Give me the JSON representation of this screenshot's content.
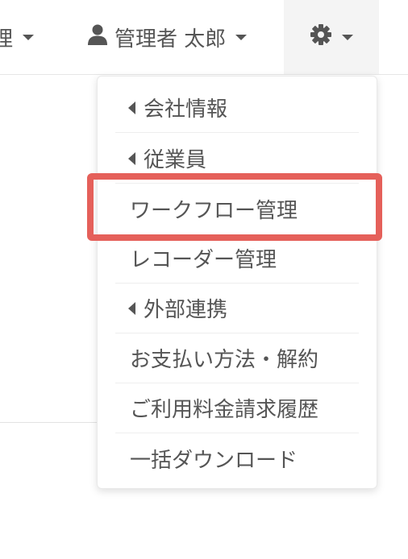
{
  "navbar": {
    "clipped_label": "理",
    "user_name": "管理者 太郎",
    "icons": {
      "user": "user-icon",
      "settings": "gear-icon"
    }
  },
  "settings_menu": {
    "items": [
      {
        "label": "会社情報",
        "submenu": true
      },
      {
        "label": "従業員",
        "submenu": true
      },
      {
        "label": "ワークフロー管理",
        "submenu": false,
        "highlighted": true
      },
      {
        "label": "レコーダー管理",
        "submenu": false
      },
      {
        "label": "外部連携",
        "submenu": true
      },
      {
        "label": "お支払い方法・解約",
        "submenu": false
      },
      {
        "label": "ご利用料金請求履歴",
        "submenu": false
      },
      {
        "label": "一括ダウンロード",
        "submenu": false
      }
    ]
  },
  "colors": {
    "text": "#555555",
    "highlight_border": "#e5605a",
    "active_nav_bg": "#f4f4f4"
  }
}
